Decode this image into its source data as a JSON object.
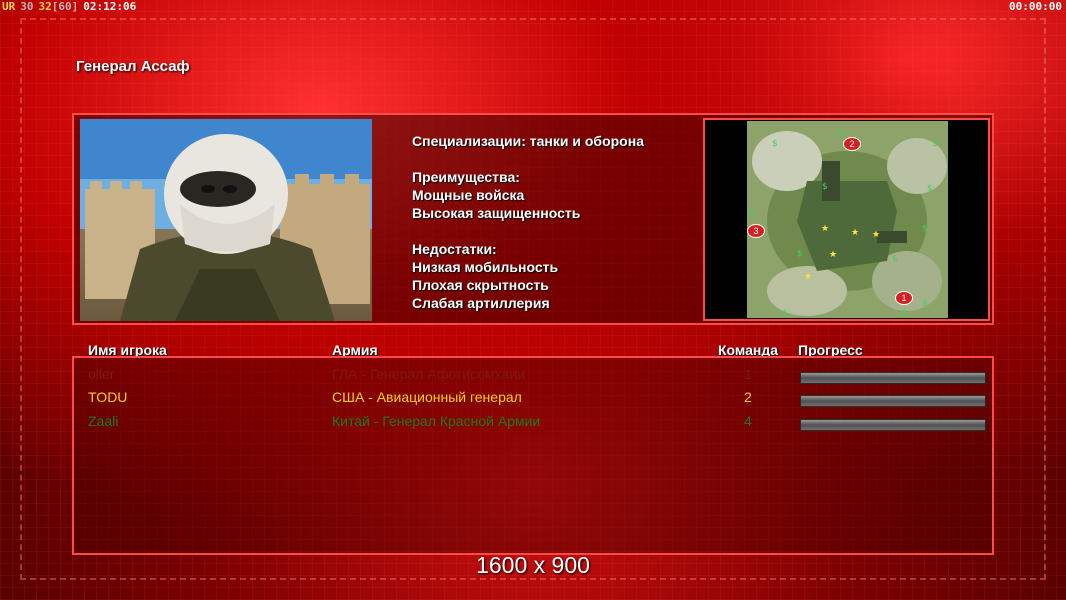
{
  "topbar": {
    "ur_label": "UR",
    "val1": "30",
    "val2": "32",
    "val3": "[60]",
    "time_left": "02:12:06",
    "time_right": "00:00:00"
  },
  "general": {
    "title": "Генерал Ассаф"
  },
  "description": {
    "specialization": "Специализации: танки и оборона",
    "advantages_header": "Преимущества:",
    "advantages": [
      "Мощные войска",
      "Высокая защищенность"
    ],
    "disadvantages_header": "Недостатки:",
    "disadvantages": [
      "Низкая мобильность",
      "Плохая скрытность",
      "Слабая артиллерия"
    ]
  },
  "map": {
    "markers": [
      "1",
      "2",
      "3"
    ]
  },
  "table": {
    "headers": {
      "name": "Имя игрока",
      "army": "Армия",
      "team": "Команда",
      "progress": "Прогресс"
    },
    "players": [
      {
        "name": "oller",
        "army": "ГЛА - Генерал Афотисомхаии",
        "team": "1",
        "color": "#7a1a10"
      },
      {
        "name": "TODU",
        "army": "США - Авиационный генерал",
        "team": "2",
        "color": "#f0d020"
      },
      {
        "name": "Zaali",
        "army": "Китай - Генерал Красной Армии",
        "team": "4",
        "color": "#1f7a1f"
      }
    ]
  },
  "resolution": "1600 x 900",
  "colors": {
    "accent": "#ff4a4a",
    "background": "#8a0000"
  }
}
